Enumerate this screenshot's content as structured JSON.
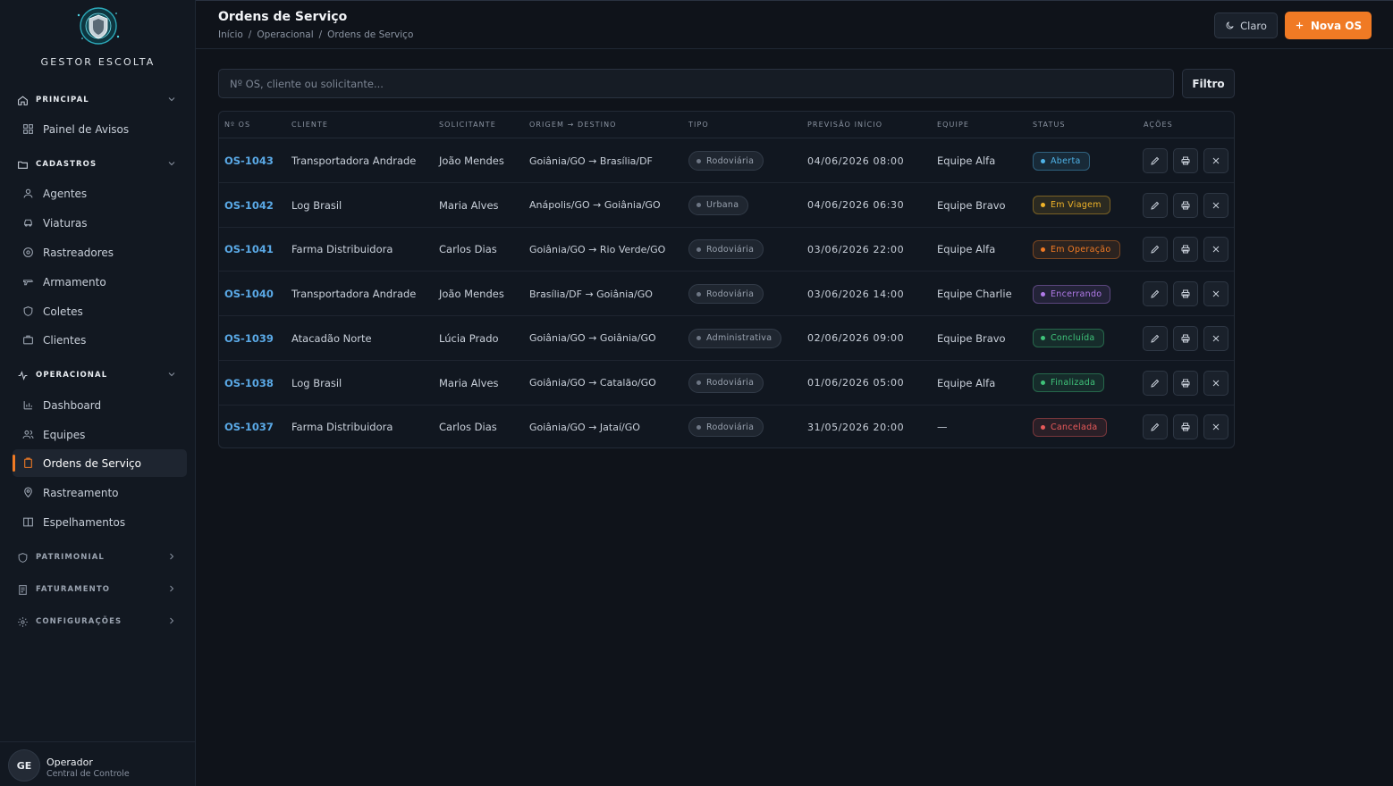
{
  "brand": {
    "name": "GESTOR ESCOLTA"
  },
  "sidebar": {
    "sections": [
      {
        "label": "PRINCIPAL",
        "icon": "home-icon",
        "expanded": true
      },
      {
        "label": "CADASTROS",
        "icon": "folder-icon",
        "expanded": true
      },
      {
        "label": "OPERACIONAL",
        "icon": "activity-icon",
        "expanded": true
      },
      {
        "label": "PATRIMONIAL",
        "icon": "shield-icon",
        "expanded": false
      },
      {
        "label": "FATURAMENTO",
        "icon": "file-icon",
        "expanded": false
      },
      {
        "label": "CONFIGURAÇÕES",
        "icon": "gear-icon",
        "expanded": false
      }
    ],
    "items": [
      {
        "label": "Painel de Avisos",
        "icon": "grid-icon"
      },
      {
        "label": "Agentes",
        "icon": "user-icon"
      },
      {
        "label": "Viaturas",
        "icon": "car-icon"
      },
      {
        "label": "Rastreadores",
        "icon": "target-icon"
      },
      {
        "label": "Armamento",
        "icon": "weapon-icon"
      },
      {
        "label": "Coletes",
        "icon": "vest-icon"
      },
      {
        "label": "Clientes",
        "icon": "briefcase-icon"
      },
      {
        "label": "Dashboard",
        "icon": "bar-chart-icon"
      },
      {
        "label": "Equipes",
        "icon": "users-icon"
      },
      {
        "label": "Ordens de Serviço",
        "icon": "clipboard-icon",
        "active": true
      },
      {
        "label": "Rastreamento",
        "icon": "map-pin-icon"
      },
      {
        "label": "Espelhamentos",
        "icon": "columns-icon"
      }
    ],
    "user": {
      "initials": "GE",
      "name": "Operador",
      "role": "Central de Controle"
    }
  },
  "header": {
    "title": "Ordens de Serviço",
    "breadcrumb": [
      "Início",
      "/",
      "Operacional",
      "/",
      "Ordens de Serviço"
    ],
    "theme_label": "Claro",
    "new_label": "Nova OS"
  },
  "search": {
    "placeholder": "Nº OS, cliente ou solicitante...",
    "filter_label": "Filtro"
  },
  "table": {
    "columns": [
      "Nº OS",
      "CLIENTE",
      "SOLICITANTE",
      "ORIGEM → DESTINO",
      "TIPO",
      "PREVISÃO INÍCIO",
      "EQUIPE",
      "STATUS",
      "AÇÕES"
    ],
    "rows": [
      {
        "os": "OS-1043",
        "cliente": "Transportadora Andrade",
        "solicitante": "João Mendes",
        "rota": "Goiânia/GO → Brasília/DF",
        "tipo": "Rodoviária",
        "previsao": "04/06/2026 08:00",
        "equipe": "Equipe Alfa",
        "status": "Aberta",
        "status_color": "#4fb3e8"
      },
      {
        "os": "OS-1042",
        "cliente": "Log Brasil",
        "solicitante": "Maria Alves",
        "rota": "Anápolis/GO → Goiânia/GO",
        "tipo": "Urbana",
        "previsao": "04/06/2026 06:30",
        "equipe": "Equipe Bravo",
        "status": "Em Viagem",
        "status_color": "#f0b429"
      },
      {
        "os": "OS-1041",
        "cliente": "Farma Distribuidora",
        "solicitante": "Carlos Dias",
        "rota": "Goiânia/GO → Rio Verde/GO",
        "tipo": "Rodoviária",
        "previsao": "03/06/2026 22:00",
        "equipe": "Equipe Alfa",
        "status": "Em Operação",
        "status_color": "#f07a24"
      },
      {
        "os": "OS-1040",
        "cliente": "Transportadora Andrade",
        "solicitante": "João Mendes",
        "rota": "Brasília/DF → Goiânia/GO",
        "tipo": "Rodoviária",
        "previsao": "03/06/2026 14:00",
        "equipe": "Equipe Charlie",
        "status": "Encerrando",
        "status_color": "#b07ae8"
      },
      {
        "os": "OS-1039",
        "cliente": "Atacadão Norte",
        "solicitante": "Lúcia Prado",
        "rota": "Goiânia/GO → Goiânia/GO",
        "tipo": "Administrativa",
        "previsao": "02/06/2026 09:00",
        "equipe": "Equipe Bravo",
        "status": "Concluída",
        "status_color": "#3fc37a"
      },
      {
        "os": "OS-1038",
        "cliente": "Log Brasil",
        "solicitante": "Maria Alves",
        "rota": "Goiânia/GO → Catalão/GO",
        "tipo": "Rodoviária",
        "previsao": "01/06/2026 05:00",
        "equipe": "Equipe Alfa",
        "status": "Finalizada",
        "status_color": "#3fc37a"
      },
      {
        "os": "OS-1037",
        "cliente": "Farma Distribuidora",
        "solicitante": "Carlos Dias",
        "rota": "Goiânia/GO → Jataí/GO",
        "tipo": "Rodoviária",
        "previsao": "31/05/2026 20:00",
        "equipe": "—",
        "status": "Cancelada",
        "status_color": "#e85a5a"
      }
    ],
    "actions": [
      {
        "name": "edit",
        "icon": "pencil-icon"
      },
      {
        "name": "print",
        "icon": "printer-icon"
      },
      {
        "name": "cancel",
        "icon": "close-icon"
      }
    ]
  },
  "colors": {
    "accent": "#f07a24",
    "link": "#5aa9e6",
    "background": "#0f131a",
    "sidebar": "#121821"
  }
}
